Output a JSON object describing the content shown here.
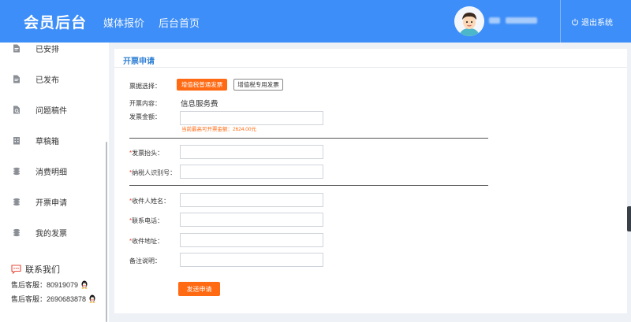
{
  "header": {
    "brand": "会员后台",
    "nav": [
      "媒体报价",
      "后台首页"
    ],
    "logout_label": "退出系统"
  },
  "sidebar": {
    "items": [
      {
        "label": "已安排",
        "icon": "document-icon"
      },
      {
        "label": "已发布",
        "icon": "document-icon"
      },
      {
        "label": "问题稿件",
        "icon": "document-search-icon"
      },
      {
        "label": "草稿箱",
        "icon": "building-icon"
      },
      {
        "label": "消费明细",
        "icon": "coins-icon"
      },
      {
        "label": "开票申请",
        "icon": "coins-icon"
      },
      {
        "label": "我的发票",
        "icon": "coins-icon"
      }
    ],
    "contact": {
      "title": "联系我们",
      "lines": [
        "售后客服：80919079",
        "售后客服：2690683878"
      ]
    }
  },
  "panel": {
    "title": "开票申请",
    "invoice_type_label": "票据选择：",
    "invoice_type_options": [
      "增值税普通发票",
      "增值税专用发票"
    ],
    "selected_type": "增值税普通发票",
    "content_label": "开票内容：",
    "content_value": "信息服务费",
    "amount_label": "发票金额：",
    "amount_value": "",
    "amount_hint": "当前最高可开票金额：2624.00元",
    "invoice_title_label": "发票抬头：",
    "invoice_title_value": "",
    "tax_id_label": "纳税人识别号：",
    "tax_id_value": "",
    "recipient_label": "收件人姓名：",
    "recipient_value": "",
    "phone_label": "联系电话：",
    "phone_value": "",
    "address_label": "收件地址：",
    "address_value": "",
    "note_label": "备注说明：",
    "note_value": "",
    "submit_label": "发送申请"
  },
  "colors": {
    "header_bg": "#3d8ef8",
    "accent_orange": "#ff6a13",
    "title_blue": "#2f7fd4"
  }
}
